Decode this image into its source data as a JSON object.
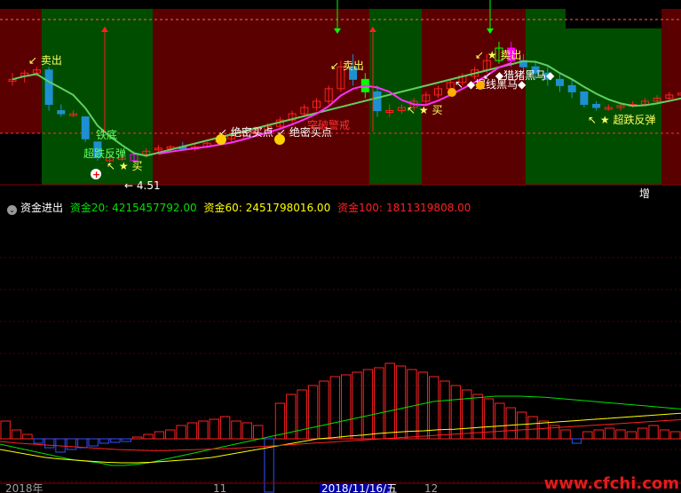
{
  "indicator": {
    "name": "资金进出",
    "items": [
      {
        "label": "资金20:",
        "value": "4215457792.00",
        "color": "#00e000"
      },
      {
        "label": "资金60:",
        "value": "2451798016.00",
        "color": "#ffff00"
      },
      {
        "label": "资金100:",
        "value": "1811319808.00",
        "color": "#ff2020"
      }
    ]
  },
  "upper_labels": {
    "sell1": "卖出",
    "sell2": "卖出",
    "sell3": "卖出",
    "bottom1": "铁底",
    "bottom2": "超跌反弹",
    "buy1": "买",
    "buy2": "买",
    "secret1": "绝密买点",
    "secret2": "绝密买点",
    "breakout": "突破警戒",
    "blackhorse1": "◆提线黑马◆",
    "blackhorse2": "◆猎猪黑马◆",
    "rebound": "超跌反弹",
    "low_price": "4.51",
    "zeng": "增"
  },
  "dates": {
    "d1": "2018年",
    "d2": "11",
    "d3": "2018/11/16/五",
    "d4": "12"
  },
  "watermark": "www.cfchi.com",
  "chart_data": [
    {
      "type": "candlestick",
      "title": "",
      "bands": [
        "red",
        "green",
        "red",
        "green",
        "red",
        "green",
        "red",
        "green"
      ],
      "candles": [
        [
          7.2,
          7.3,
          7.1,
          7.2
        ],
        [
          7.25,
          7.35,
          7.15,
          7.3
        ],
        [
          7.3,
          7.4,
          7.25,
          7.35
        ],
        [
          7.35,
          7.4,
          6.7,
          6.8
        ],
        [
          6.7,
          6.8,
          6.6,
          6.65
        ],
        [
          6.65,
          6.7,
          6.6,
          6.65
        ],
        [
          6.6,
          6.6,
          6.2,
          6.25
        ],
        [
          6.2,
          6.2,
          5.9,
          5.95
        ],
        [
          5.9,
          6.0,
          5.85,
          5.95
        ],
        [
          5.95,
          6.0,
          5.9,
          5.95
        ],
        [
          5.9,
          6.05,
          5.88,
          6.0
        ],
        [
          6.0,
          6.1,
          5.95,
          6.05
        ],
        [
          6.1,
          6.15,
          6.0,
          6.1
        ],
        [
          6.1,
          6.15,
          6.05,
          6.12
        ],
        [
          6.12,
          6.2,
          6.08,
          6.1
        ],
        [
          6.1,
          6.15,
          6.05,
          6.12
        ],
        [
          6.12,
          6.2,
          6.1,
          6.18
        ],
        [
          6.2,
          6.3,
          6.15,
          6.25
        ],
        [
          6.25,
          6.35,
          6.2,
          6.3
        ],
        [
          6.3,
          6.4,
          6.25,
          6.35
        ],
        [
          6.35,
          6.45,
          6.3,
          6.4
        ],
        [
          6.4,
          6.5,
          6.35,
          6.45
        ],
        [
          6.45,
          6.6,
          6.4,
          6.55
        ],
        [
          6.55,
          6.7,
          6.5,
          6.65
        ],
        [
          6.65,
          6.8,
          6.6,
          6.75
        ],
        [
          6.75,
          6.9,
          6.7,
          6.85
        ],
        [
          6.85,
          7.1,
          6.8,
          7.05
        ],
        [
          7.05,
          7.5,
          7.0,
          7.4
        ],
        [
          7.4,
          7.6,
          7.1,
          7.2
        ],
        [
          7.2,
          7.3,
          6.9,
          7.0
        ],
        [
          7.0,
          7.1,
          6.6,
          6.7
        ],
        [
          6.7,
          6.8,
          6.6,
          6.7
        ],
        [
          6.7,
          6.8,
          6.65,
          6.75
        ],
        [
          6.75,
          6.9,
          6.7,
          6.85
        ],
        [
          6.85,
          7.0,
          6.8,
          6.95
        ],
        [
          6.95,
          7.1,
          6.9,
          7.05
        ],
        [
          7.05,
          7.2,
          7.0,
          7.15
        ],
        [
          7.15,
          7.3,
          7.1,
          7.25
        ],
        [
          7.25,
          7.4,
          7.2,
          7.35
        ],
        [
          7.35,
          7.6,
          7.3,
          7.5
        ],
        [
          7.5,
          7.8,
          7.45,
          7.7
        ],
        [
          7.7,
          7.8,
          7.4,
          7.5
        ],
        [
          7.5,
          7.6,
          7.3,
          7.4
        ],
        [
          7.4,
          7.5,
          7.2,
          7.3
        ],
        [
          7.3,
          7.4,
          7.1,
          7.2
        ],
        [
          7.2,
          7.3,
          7.0,
          7.1
        ],
        [
          7.1,
          7.2,
          6.9,
          7.0
        ],
        [
          7.0,
          7.0,
          6.75,
          6.8
        ],
        [
          6.8,
          6.85,
          6.7,
          6.75
        ],
        [
          6.75,
          6.8,
          6.7,
          6.75
        ],
        [
          6.75,
          6.8,
          6.7,
          6.78
        ],
        [
          6.8,
          6.85,
          6.75,
          6.8
        ],
        [
          6.8,
          6.9,
          6.78,
          6.85
        ],
        [
          6.85,
          6.95,
          6.8,
          6.9
        ],
        [
          6.9,
          7.0,
          6.85,
          6.95
        ],
        [
          6.95,
          7.0,
          6.9,
          6.98
        ]
      ]
    },
    {
      "type": "bar",
      "title": "资金进出",
      "bars": [
        0.2,
        0.1,
        0.05,
        -0.05,
        -0.1,
        -0.15,
        -0.12,
        -0.1,
        -0.08,
        -0.05,
        -0.04,
        -0.03,
        0.02,
        0.05,
        0.08,
        0.1,
        0.15,
        0.18,
        0.2,
        0.22,
        0.25,
        0.2,
        0.18,
        0.15,
        -0.6,
        0.4,
        0.5,
        0.55,
        0.6,
        0.65,
        0.7,
        0.72,
        0.75,
        0.78,
        0.8,
        0.85,
        0.82,
        0.78,
        0.75,
        0.7,
        0.65,
        0.6,
        0.55,
        0.5,
        0.45,
        0.4,
        0.35,
        0.3,
        0.25,
        0.2,
        0.15,
        0.1,
        -0.05,
        0.08,
        0.1,
        0.12,
        0.1,
        0.08,
        0.12,
        0.15,
        0.1,
        0.08
      ],
      "series": [
        {
          "name": "资金20",
          "color": "#00e000",
          "values": [
            -0.1,
            -0.15,
            -0.2,
            -0.25,
            -0.3,
            -0.35,
            -0.4,
            -0.42,
            -0.45,
            -0.5,
            -0.5,
            -0.48,
            -0.45,
            -0.4,
            -0.35,
            -0.3,
            -0.25,
            -0.2,
            -0.15,
            -0.1,
            -0.05,
            0.0,
            0.05,
            0.1,
            0.15,
            0.2,
            0.25,
            0.3,
            0.35,
            0.4,
            0.45,
            0.5,
            0.55,
            0.6,
            0.65,
            0.7,
            0.72,
            0.74,
            0.76,
            0.78,
            0.8,
            0.8,
            0.8,
            0.79,
            0.78,
            0.76,
            0.74,
            0.72,
            0.7,
            0.68,
            0.66,
            0.64,
            0.62,
            0.6,
            0.58,
            0.56
          ]
        },
        {
          "name": "资金60",
          "color": "#ffff00",
          "values": [
            -0.2,
            -0.25,
            -0.3,
            -0.35,
            -0.38,
            -0.4,
            -0.42,
            -0.44,
            -0.45,
            -0.45,
            -0.44,
            -0.42,
            -0.4,
            -0.38,
            -0.35,
            -0.3,
            -0.25,
            -0.2,
            -0.15,
            -0.1,
            -0.05,
            0.0,
            0.02,
            0.05,
            0.07,
            0.1,
            0.12,
            0.14,
            0.15,
            0.17,
            0.18,
            0.2,
            0.22,
            0.24,
            0.26,
            0.28,
            0.3,
            0.32,
            0.34,
            0.36,
            0.38,
            0.4,
            0.42,
            0.44,
            0.46,
            0.48
          ]
        },
        {
          "name": "资金100",
          "color": "#ff2020",
          "values": [
            -0.05,
            -0.08,
            -0.1,
            -0.12,
            -0.14,
            -0.16,
            -0.18,
            -0.2,
            -0.21,
            -0.22,
            -0.22,
            -0.21,
            -0.2,
            -0.19,
            -0.18,
            -0.16,
            -0.14,
            -0.12,
            -0.1,
            -0.08,
            -0.06,
            -0.04,
            -0.02,
            0.0,
            0.02,
            0.04,
            0.06,
            0.08,
            0.1,
            0.12,
            0.14,
            0.16,
            0.18,
            0.2,
            0.22,
            0.24,
            0.26,
            0.28,
            0.3,
            0.32,
            0.34,
            0.36
          ]
        }
      ]
    }
  ]
}
